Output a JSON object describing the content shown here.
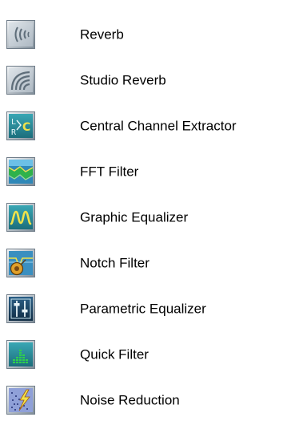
{
  "effects": [
    {
      "label": "Reverb",
      "icon": "reverb-icon"
    },
    {
      "label": "Studio Reverb",
      "icon": "studio-reverb-icon"
    },
    {
      "label": "Central Channel Extractor",
      "icon": "central-channel-extractor-icon"
    },
    {
      "label": "FFT Filter",
      "icon": "fft-filter-icon"
    },
    {
      "label": "Graphic Equalizer",
      "icon": "graphic-equalizer-icon"
    },
    {
      "label": "Notch Filter",
      "icon": "notch-filter-icon"
    },
    {
      "label": "Parametric Equalizer",
      "icon": "parametric-equalizer-icon"
    },
    {
      "label": "Quick Filter",
      "icon": "quick-filter-icon"
    },
    {
      "label": "Noise Reduction",
      "icon": "noise-reduction-icon"
    }
  ],
  "colors": {
    "icon_frame": "#9aa8b4",
    "icon_face": "#c9d2da",
    "teal": "#2a8a96",
    "navy": "#1a3f5c",
    "green": "#27a84a",
    "yellow": "#f0e24a"
  }
}
